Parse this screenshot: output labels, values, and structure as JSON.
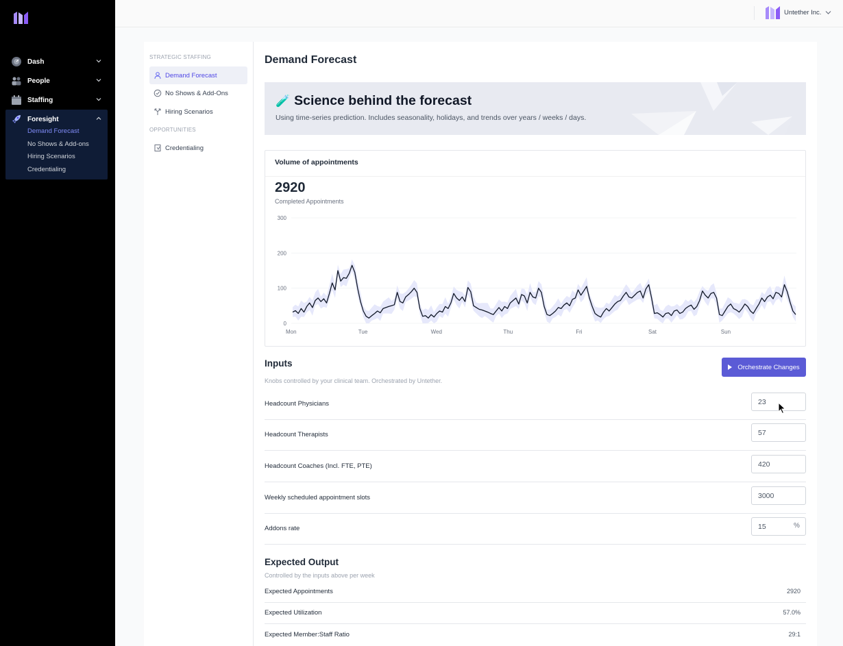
{
  "sidebar": {
    "nav": [
      {
        "label": "Dash",
        "icon": "dashboard-icon"
      },
      {
        "label": "People",
        "icon": "people-icon"
      },
      {
        "label": "Staffing",
        "icon": "calendar-icon"
      },
      {
        "label": "Foresight",
        "icon": "rocket-icon"
      }
    ],
    "foresight_sub": [
      "Demand Forecast",
      "No Shows & Add-ons",
      "Hiring Scenarios",
      "Credentialing"
    ]
  },
  "topbar": {
    "org_name": "Untether Inc."
  },
  "subnav": {
    "heading_strategic": "STRATEGIC STAFFING",
    "heading_opportunities": "OPPORTUNITIES",
    "items": [
      "Demand Forecast",
      "No Shows & Add-Ons",
      "Hiring Scenarios",
      "Credentialing"
    ]
  },
  "page": {
    "title": "Demand Forecast"
  },
  "banner": {
    "emoji": "🧪",
    "title": "Science behind the forecast",
    "subtitle": "Using time-series prediction. Includes seasonality, holidays, and trends over years / weeks / days."
  },
  "chart_card": {
    "title": "Volume of appointments",
    "big_number": "2920",
    "big_label": "Completed Appointments"
  },
  "chart_data": {
    "type": "line",
    "x_ticks": [
      "Mon",
      "Tue",
      "Wed",
      "Thu",
      "Fri",
      "Sat",
      "Sun"
    ],
    "y_ticks": [
      0,
      100,
      200,
      300
    ],
    "ylim": [
      0,
      300
    ],
    "colors": {
      "line": "#111827",
      "band": "#e6e8fb",
      "grid": "#f3f4f6"
    },
    "series": [
      {
        "values": [
          32,
          36,
          28,
          42,
          32,
          48,
          58,
          45,
          65,
          72,
          62,
          70,
          58,
          85,
          115,
          95,
          150,
          120,
          130,
          128,
          142,
          165,
          145,
          100,
          62,
          35,
          20,
          15,
          22,
          28,
          35,
          30,
          42,
          45,
          48,
          50,
          53,
          88,
          62,
          58,
          75,
          82,
          90,
          100,
          88,
          42,
          20,
          22,
          15,
          25,
          18,
          28,
          35,
          32,
          48,
          42,
          58,
          85,
          72,
          65,
          75,
          62,
          102,
          90,
          50,
          45,
          40,
          38,
          35,
          32,
          28,
          25,
          35,
          45,
          35,
          48,
          42,
          58,
          65,
          72,
          55,
          82,
          78,
          58,
          88,
          75,
          72,
          100,
          88,
          48,
          25,
          22,
          28,
          35,
          45,
          42,
          52,
          58,
          50,
          68,
          72,
          95,
          80,
          92,
          105,
          72,
          48,
          28,
          22,
          18,
          32,
          42,
          35,
          45,
          55,
          62,
          65,
          78,
          88,
          75,
          72,
          80,
          88,
          92,
          72,
          98,
          110,
          72,
          28,
          30,
          25,
          18,
          28,
          30,
          22,
          35,
          38,
          28,
          32,
          42,
          48,
          52,
          40,
          48,
          65,
          92,
          80,
          72,
          85,
          88,
          72,
          25,
          22,
          35,
          48,
          55,
          42,
          38,
          32,
          42,
          55,
          48,
          35,
          28,
          42,
          55,
          72,
          62,
          75,
          80,
          70,
          88,
          85,
          75,
          110,
          90,
          60,
          35,
          25
        ]
      }
    ]
  },
  "inputs": {
    "title": "Inputs",
    "subtitle": "Knobs controlled by your clinical team. Orchestrated by Untether.",
    "button_label": "Orchestrate Changes",
    "rows": [
      {
        "label": "Headcount Physicians",
        "value": "23"
      },
      {
        "label": "Headcount Therapists",
        "value": "57"
      },
      {
        "label": "Headcount Coaches (Incl. FTE, PTE)",
        "value": "420"
      },
      {
        "label": "Weekly scheduled appointment slots",
        "value": "3000"
      },
      {
        "label": "Addons rate",
        "value": "15",
        "suffix": "%"
      }
    ]
  },
  "outputs": {
    "title": "Expected Output",
    "subtitle": "Controlled by the inputs above per week",
    "rows": [
      {
        "label": "Expected Appointments",
        "value": "2920"
      },
      {
        "label": "Expected Utilization",
        "value": "57.0%"
      },
      {
        "label": "Expected Member:Staff Ratio",
        "value": "29:1"
      }
    ]
  }
}
